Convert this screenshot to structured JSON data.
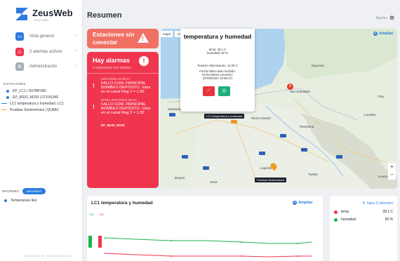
{
  "app": {
    "name": "ZeusWeb",
    "sub": "ZEUS WEB"
  },
  "nav": [
    {
      "label": "Vista general",
      "color": "#2d7be0",
      "glyph": "▭"
    },
    {
      "label": "2 alarmas activos",
      "color": "#f0364f",
      "glyph": "⚠"
    },
    {
      "label": "Administración",
      "color": "#a6adb8",
      "glyph": "⚙"
    }
  ],
  "stations": {
    "title": "ESTACIONES",
    "items": [
      {
        "label": "EP_LC1 | 0U7MFS82",
        "color": "#2d7be0",
        "kind": "dot"
      },
      {
        "label": "EP_M102_M130 | 07XX6JNF",
        "color": "#2d7be0",
        "kind": "dot"
      },
      {
        "label": "LC1 temperatura y humedad | LC1",
        "color": "#2d7be0",
        "kind": "dash"
      },
      {
        "label": "Pruebas Sentemónica | QU8A2",
        "color": "#e9b020",
        "kind": "dash"
      }
    ]
  },
  "informes": {
    "title": "INFORMES",
    "pill": "INFORMES",
    "item": "Temperatura Iker"
  },
  "footer": "ZEUS WEB BY MICROCOM 2022",
  "page": {
    "title": "Resumen",
    "settings": "Ajustes"
  },
  "cards": {
    "disconnect": "Estaciones sin conectar",
    "alarms_title": "Hay alarmas",
    "alarms_sub": "1 estaciones con alarma",
    "alarms": [
      {
        "date": "22/07/2022 23:00:17",
        "msg": "FALLO COM. PRINCIPAL BOMBEO DEPÓSITO. Valor en el canal Flag 2 = 1.00",
        "station": ""
      },
      {
        "date": "EP001 08/07/2022 06:43:...",
        "msg": "FALLO COM. PRINCIPAL BOMBEO DEPÓSITO. Valor en el canal Flag 2 = 1.00",
        "station": "EP_M102_M130"
      }
    ]
  },
  "map": {
    "tabs": [
      "mapa",
      "satélite"
    ],
    "ampliar": "Ampliar",
    "popup": {
      "title": "temperatura y humedad",
      "lines": [
        "temp: 28.1 C",
        "humedad: 50 %",
        "",
        "Tensión Alimentación: 12.00 V",
        "Fecha último dato recibido:",
        "Fecha última conexión:",
        "(07/08/2022 10:09:17)"
      ]
    },
    "pins": [
      {
        "label": "LC1 temperatura y humedad"
      },
      {
        "label": "Pruebas Sentemónica"
      }
    ],
    "places": [
      "Bilbao",
      "San Sebastián",
      "Vitoria-Gasteiz",
      "Pamplona",
      "Logroño",
      "Santander",
      "Pau",
      "Burgos",
      "Bayonne",
      "Lourdes",
      "Tudela",
      "Huesca",
      "Soria"
    ]
  },
  "chart": {
    "title": "LC1 temperatura y humedad",
    "ampliar": "Ampliar",
    "legend": [
      "100",
      "100"
    ]
  },
  "recent": {
    "since": "hace 0 minutos",
    "rows": [
      {
        "name": "temp",
        "value": "28,1 C",
        "color": "#f0364f"
      },
      {
        "name": "humedad",
        "value": "50 %",
        "color": "#1bb34a"
      }
    ]
  }
}
